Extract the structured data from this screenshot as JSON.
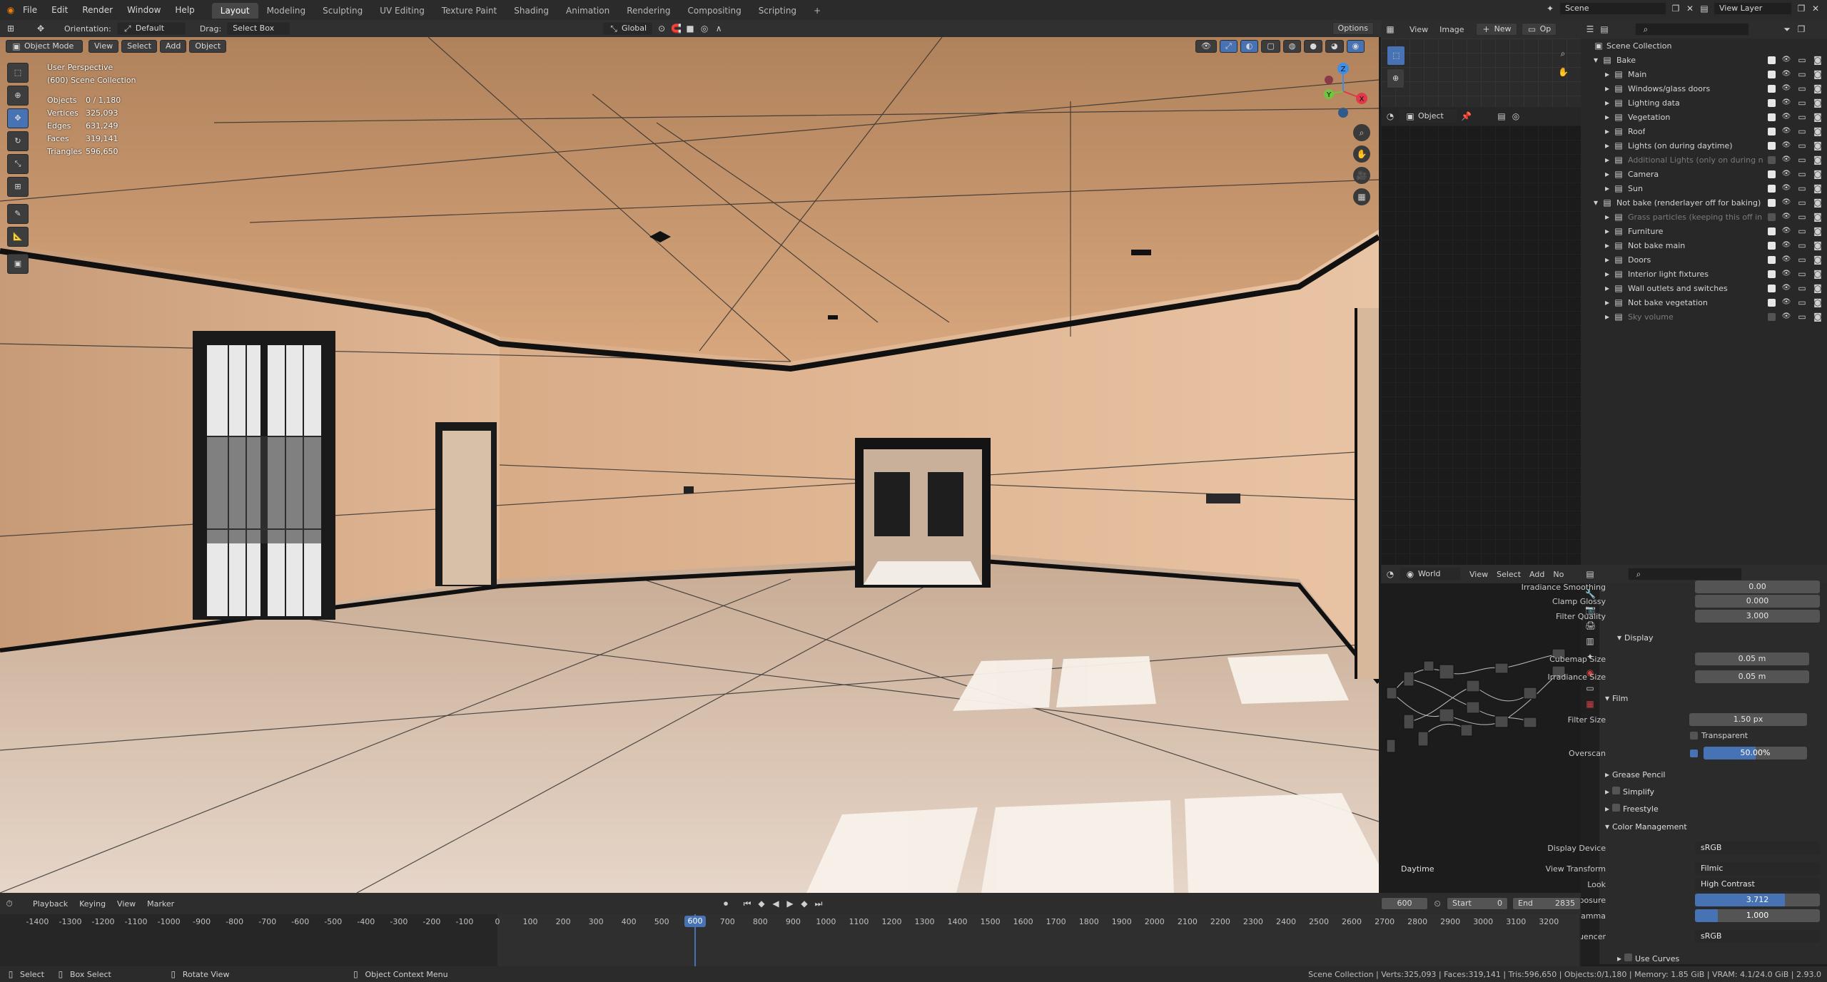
{
  "topbar": {
    "menus": [
      "File",
      "Edit",
      "Render",
      "Window",
      "Help"
    ],
    "workspaces": [
      "Layout",
      "Modeling",
      "Sculpting",
      "UV Editing",
      "Texture Paint",
      "Shading",
      "Animation",
      "Rendering",
      "Compositing",
      "Scripting"
    ],
    "active_workspace": "Layout",
    "scene_label": "Scene",
    "view_layer_label": "View Layer"
  },
  "viewport": {
    "orientation_label": "Orientation:",
    "orientation_value": "Default",
    "drag_label": "Drag:",
    "drag_value": "Select Box",
    "transform_orientation": "Global",
    "options_label": "Options",
    "mode": "Object Mode",
    "header_menus": [
      "View",
      "Select",
      "Add",
      "Object"
    ],
    "overlay_title": "User Perspective",
    "overlay_collection": "(600) Scene Collection",
    "stats": [
      {
        "label": "Objects",
        "value": "0 / 1,180"
      },
      {
        "label": "Vertices",
        "value": "325,093"
      },
      {
        "label": "Edges",
        "value": "631,249"
      },
      {
        "label": "Faces",
        "value": "319,141"
      },
      {
        "label": "Triangles",
        "value": "596,650"
      }
    ],
    "gizmo_axes": {
      "z": "Z",
      "y": "Y",
      "x": "X"
    },
    "colors": {
      "x_axis": "#e0394a",
      "y_axis": "#6fc53f",
      "z_axis": "#3d8ee8"
    }
  },
  "image_editor": {
    "menus": [
      "View",
      "Image"
    ],
    "new_label": "New",
    "open_label": "Op",
    "object_dropdown": "Object"
  },
  "node_editor": {
    "world_dropdown": "World",
    "menus": [
      "View",
      "Select",
      "Add",
      "No"
    ],
    "node_tree_name": "Daytime"
  },
  "outliner": {
    "root": "Scene Collection",
    "items": [
      {
        "label": "Bake",
        "depth": 0,
        "dim": false
      },
      {
        "label": "Main",
        "depth": 1,
        "dim": false
      },
      {
        "label": "Windows/glass doors",
        "depth": 1,
        "dim": false
      },
      {
        "label": "Lighting data",
        "depth": 1,
        "dim": false
      },
      {
        "label": "Vegetation",
        "depth": 1,
        "dim": false
      },
      {
        "label": "Roof",
        "depth": 1,
        "dim": false
      },
      {
        "label": "Lights (on during daytime)",
        "depth": 1,
        "dim": false
      },
      {
        "label": "Additional Lights (only on during ni",
        "depth": 1,
        "dim": true
      },
      {
        "label": "Camera",
        "depth": 1,
        "dim": false
      },
      {
        "label": "Sun",
        "depth": 1,
        "dim": false
      },
      {
        "label": "Not bake (renderlayer off for baking)",
        "depth": 0,
        "dim": false
      },
      {
        "label": "Grass particles (keeping this off in",
        "depth": 1,
        "dim": true
      },
      {
        "label": "Furniture",
        "depth": 1,
        "dim": false
      },
      {
        "label": "Not bake main",
        "depth": 1,
        "dim": false
      },
      {
        "label": "Doors",
        "depth": 1,
        "dim": false
      },
      {
        "label": "Interior light fixtures",
        "depth": 1,
        "dim": false
      },
      {
        "label": "Wall outlets and switches",
        "depth": 1,
        "dim": false
      },
      {
        "label": "Not bake vegetation",
        "depth": 1,
        "dim": false
      },
      {
        "label": "Sky volume",
        "depth": 1,
        "dim": true
      }
    ]
  },
  "properties": {
    "rows": [
      {
        "label": "Irradiance Smoothing",
        "value": "0.00"
      },
      {
        "label": "Clamp Glossy",
        "value": "0.000"
      },
      {
        "label": "Filter Quality",
        "value": "3.000"
      }
    ],
    "display_section": "Display",
    "cubemap_size_label": "Cubemap Size",
    "cubemap_size": "0.05 m",
    "irradiance_size_label": "Irradiance Size",
    "irradiance_size": "0.05 m",
    "film_section": "Film",
    "filter_size_label": "Filter Size",
    "filter_size": "1.50 px",
    "transparent_label": "Transparent",
    "overscan_label": "Overscan",
    "overscan_value": "50.00%",
    "overscan_fill": 0.5,
    "grease_pencil": "Grease Pencil",
    "simplify": "Simplify",
    "freestyle": "Freestyle",
    "color_management": "Color Management",
    "display_device_label": "Display Device",
    "display_device": "sRGB",
    "view_transform_label": "View Transform",
    "view_transform": "Filmic",
    "look_label": "Look",
    "look": "High Contrast",
    "exposure_label": "Exposure",
    "exposure": "3.712",
    "exposure_fill": 0.72,
    "gamma_label": "Gamma",
    "gamma": "1.000",
    "gamma_fill": 0.18,
    "sequencer_label": "Sequencer",
    "sequencer": "sRGB",
    "use_curves": "Use Curves"
  },
  "timeline": {
    "menus": [
      "Playback",
      "Keying",
      "View",
      "Marker"
    ],
    "current_frame": "600",
    "start_label": "Start",
    "start": "0",
    "end_label": "End",
    "end": "2835",
    "ticks": [
      "-1400",
      "-1300",
      "-1200",
      "-1100",
      "-1000",
      "-900",
      "-800",
      "-700",
      "-600",
      "-500",
      "-400",
      "-300",
      "-200",
      "-100",
      "0",
      "100",
      "200",
      "300",
      "400",
      "500",
      "600",
      "700",
      "800",
      "900",
      "1000",
      "1100",
      "1200",
      "1300",
      "1400",
      "1500",
      "1600",
      "1700",
      "1800",
      "1900",
      "2000",
      "2100",
      "2200",
      "2300",
      "2400",
      "2500",
      "2600",
      "2700",
      "2800",
      "2900",
      "3000",
      "3100",
      "3200"
    ],
    "playhead_label": "600"
  },
  "statusbar": {
    "select": "Select",
    "box_select": "Box Select",
    "rotate_view": "Rotate View",
    "context_menu": "Object Context Menu",
    "stats": "Scene Collection | Verts:325,093 | Faces:319,141 | Tris:596,650 | Objects:0/1,180 | Memory: 1.85 GiB | VRAM: 4.1/24.0 GiB | 2.93.0"
  }
}
